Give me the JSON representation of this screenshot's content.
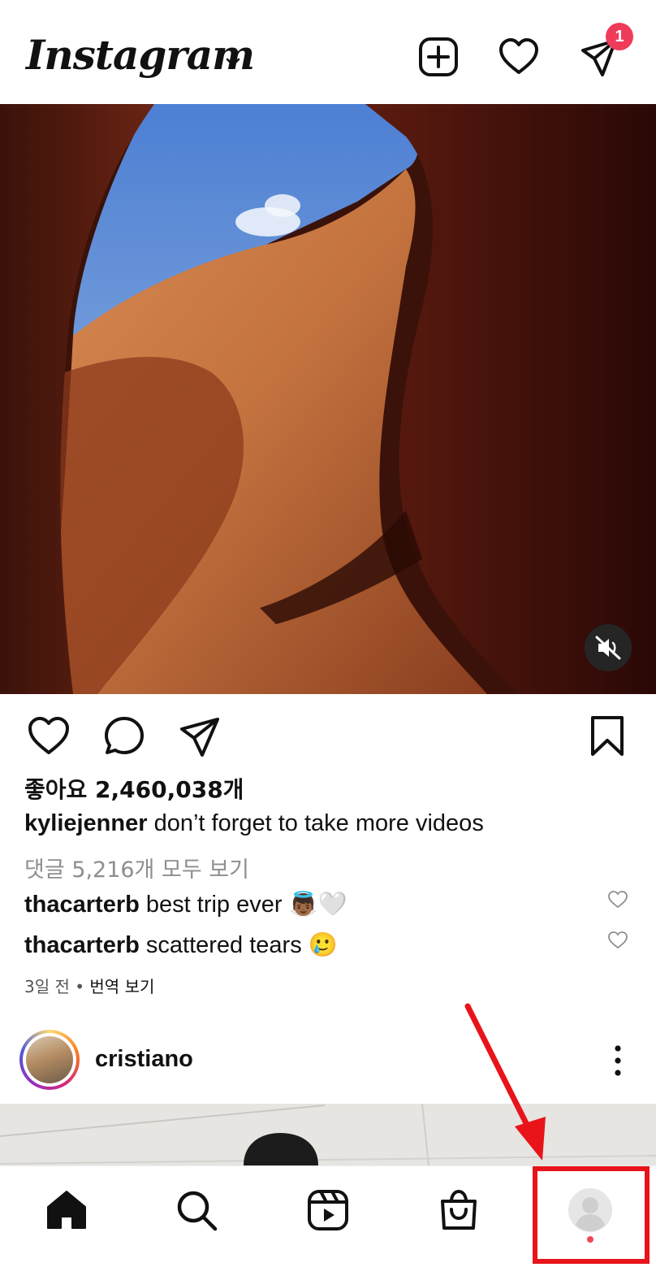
{
  "header": {
    "logo": "Instagram",
    "dm_badge_count": "1"
  },
  "icons": {
    "caret": "chevron-down-icon",
    "new_post": "plus-square-icon",
    "activity": "heart-icon",
    "direct": "send-icon",
    "mute": "speaker-muted-icon",
    "like": "heart-icon",
    "comment": "comment-icon",
    "share": "send-icon",
    "save": "bookmark-icon",
    "more": "more-vertical-icon",
    "home": "home-icon",
    "search": "search-icon",
    "reels": "reels-icon",
    "shop": "shopping-bag-icon",
    "profile": "profile-avatar-icon"
  },
  "post": {
    "likes": "좋아요 2,460,038개",
    "caption_user": "kyliejenner",
    "caption_text": " don’t forget to take more videos",
    "view_comments": "댓글 5,216개 모두 보기",
    "comments": [
      {
        "user": "thacarterb",
        "text": " best trip ever 👼🏾🤍"
      },
      {
        "user": "thacarterb",
        "text": " scattered tears 🥲"
      }
    ],
    "time": "3일 전",
    "separator": " • ",
    "translate": "번역 보기"
  },
  "next_post": {
    "username": "cristiano"
  },
  "colors": {
    "badge": "#ef3b5a",
    "highlight": "#e8141a",
    "profile_dot": "#ed4956"
  }
}
